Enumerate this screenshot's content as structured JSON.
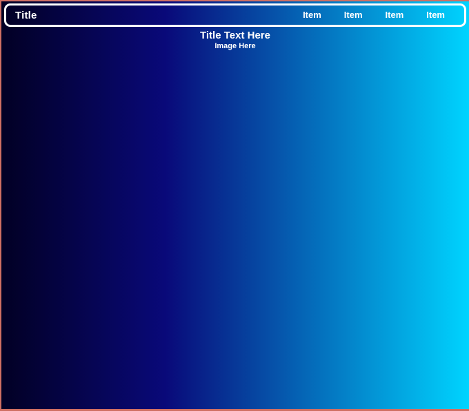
{
  "page": {
    "border_color": "#cf6f63",
    "background_gradient": {
      "start": "#020024",
      "mid": "#090979",
      "mid_stop": "35%",
      "end": "#00d4ff"
    }
  },
  "navbar": {
    "brand": "Title",
    "border_color": "#ffffff",
    "text_color": "#ffffff",
    "items": [
      {
        "label": "Item"
      },
      {
        "label": "Item"
      },
      {
        "label": "Item"
      },
      {
        "label": "Item"
      }
    ]
  },
  "hero": {
    "title": "Title Text Here",
    "subtitle": "Image Here"
  }
}
